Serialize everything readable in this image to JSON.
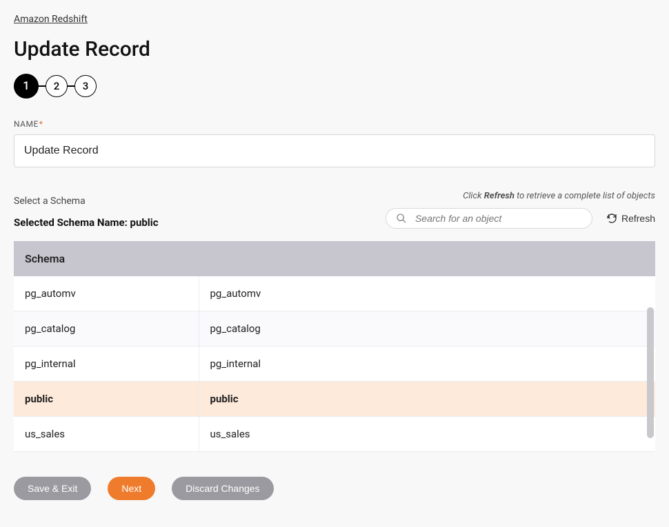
{
  "breadcrumb": "Amazon Redshift",
  "title": "Update Record",
  "stepper": {
    "steps": [
      "1",
      "2",
      "3"
    ],
    "active_index": 0
  },
  "name_field": {
    "label": "NAME",
    "required_marker": "*",
    "value": "Update Record"
  },
  "schema": {
    "select_label": "Select a Schema",
    "selected_prefix": "Selected Schema Name: ",
    "selected_value": "public",
    "hint_prefix": "Click ",
    "hint_bold": "Refresh",
    "hint_suffix": " to retrieve a complete list of objects",
    "search_placeholder": "Search for an object",
    "refresh_label": "Refresh"
  },
  "table": {
    "header": "Schema",
    "rows": [
      {
        "c1": "pg_automv",
        "c2": "pg_automv",
        "alt": false,
        "selected": false
      },
      {
        "c1": "pg_catalog",
        "c2": "pg_catalog",
        "alt": true,
        "selected": false
      },
      {
        "c1": "pg_internal",
        "c2": "pg_internal",
        "alt": false,
        "selected": false
      },
      {
        "c1": "public",
        "c2": "public",
        "alt": false,
        "selected": true
      },
      {
        "c1": "us_sales",
        "c2": "us_sales",
        "alt": false,
        "selected": false
      }
    ]
  },
  "footer": {
    "save_exit": "Save & Exit",
    "next": "Next",
    "discard": "Discard Changes"
  }
}
